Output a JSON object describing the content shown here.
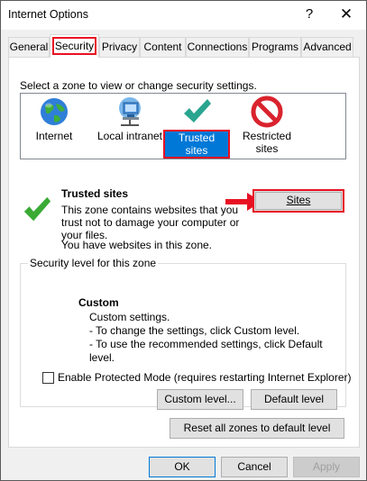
{
  "window": {
    "title": "Internet Options",
    "help_glyph": "?",
    "close_glyph": "✕"
  },
  "tabs": [
    {
      "label": "General"
    },
    {
      "label": "Security"
    },
    {
      "label": "Privacy"
    },
    {
      "label": "Content"
    },
    {
      "label": "Connections"
    },
    {
      "label": "Programs"
    },
    {
      "label": "Advanced"
    }
  ],
  "security": {
    "instruction": "Select a zone to view or change security settings.",
    "zones": [
      {
        "label": "Internet",
        "icon": "globe-icon"
      },
      {
        "label": "Local intranet",
        "icon": "network-computer-icon"
      },
      {
        "label": "Trusted sites",
        "icon": "checkmark-icon"
      },
      {
        "label": "Restricted sites",
        "label_line1": "Restricted",
        "label_line2": "sites",
        "icon": "no-entry-icon"
      }
    ],
    "selected_zone": "Trusted sites",
    "zone_title": "Trusted sites",
    "zone_desc_1": "This zone contains websites that you",
    "zone_desc_2": "trust not to damage your computer or",
    "zone_desc_3": "your files.",
    "zone_desc_4": "You have websites in this zone.",
    "sites_button": "Sites",
    "level_group_label": "Security level for this zone",
    "custom_title": "Custom",
    "custom_line1": "Custom settings.",
    "custom_line2": "- To change the settings, click Custom level.",
    "custom_line3": "- To use the recommended settings, click Default level.",
    "protected_mode_label": "Enable Protected Mode (requires restarting Internet Explorer)",
    "protected_mode_checked": false,
    "custom_level_button": "Custom level...",
    "default_level_button": "Default level",
    "reset_button": "Reset all zones to default level"
  },
  "footer": {
    "ok": "OK",
    "cancel": "Cancel",
    "apply": "Apply"
  },
  "colors": {
    "highlight": "#e81123",
    "selection": "#0078d7",
    "check": "#3aaa35"
  }
}
